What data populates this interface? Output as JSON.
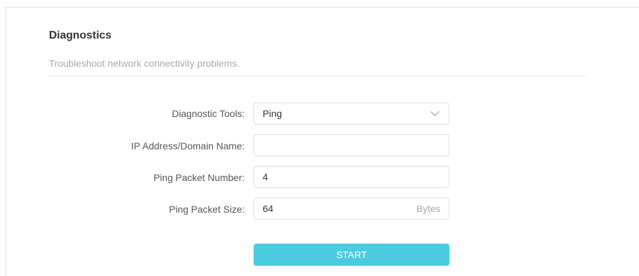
{
  "header": {
    "title": "Diagnostics",
    "subtitle": "Troubleshoot network connectivity problems."
  },
  "form": {
    "tool": {
      "label": "Diagnostic Tools:",
      "value": "Ping"
    },
    "address": {
      "label": "IP Address/Domain Name:",
      "value": ""
    },
    "packet_number": {
      "label": "Ping Packet Number:",
      "value": "4"
    },
    "packet_size": {
      "label": "Ping Packet Size:",
      "value": "64",
      "unit": "Bytes"
    },
    "start_label": "START"
  },
  "colors": {
    "accent": "#4acbdf",
    "border": "#dcdcdc",
    "muted": "#a8a8a8"
  },
  "icons": {
    "dropdown": "chevron-down-icon"
  }
}
